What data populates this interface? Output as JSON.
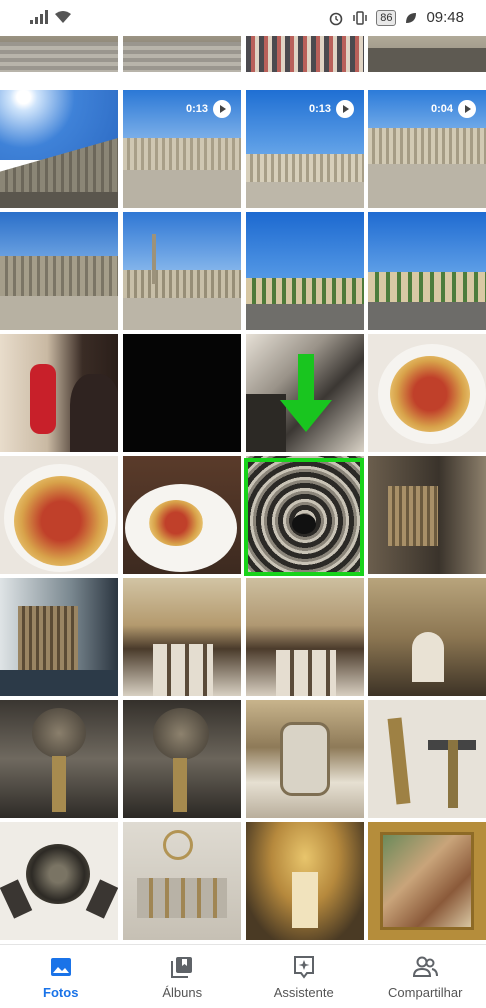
{
  "status_bar": {
    "battery": "86",
    "time": "09:48"
  },
  "grid": {
    "video_durations": {
      "r1c2": "0:13",
      "r1c3": "0:13",
      "r1c4": "0:04"
    }
  },
  "bottom_nav": {
    "items": [
      {
        "label": "Fotos",
        "icon": "photo-icon",
        "active": true
      },
      {
        "label": "Álbuns",
        "icon": "albums-icon",
        "active": false
      },
      {
        "label": "Assistente",
        "icon": "assistant-icon",
        "active": false
      },
      {
        "label": "Compartilhar",
        "icon": "share-people-icon",
        "active": false
      }
    ]
  },
  "colors": {
    "accent": "#1a73e8",
    "highlight": "#19d31b"
  }
}
